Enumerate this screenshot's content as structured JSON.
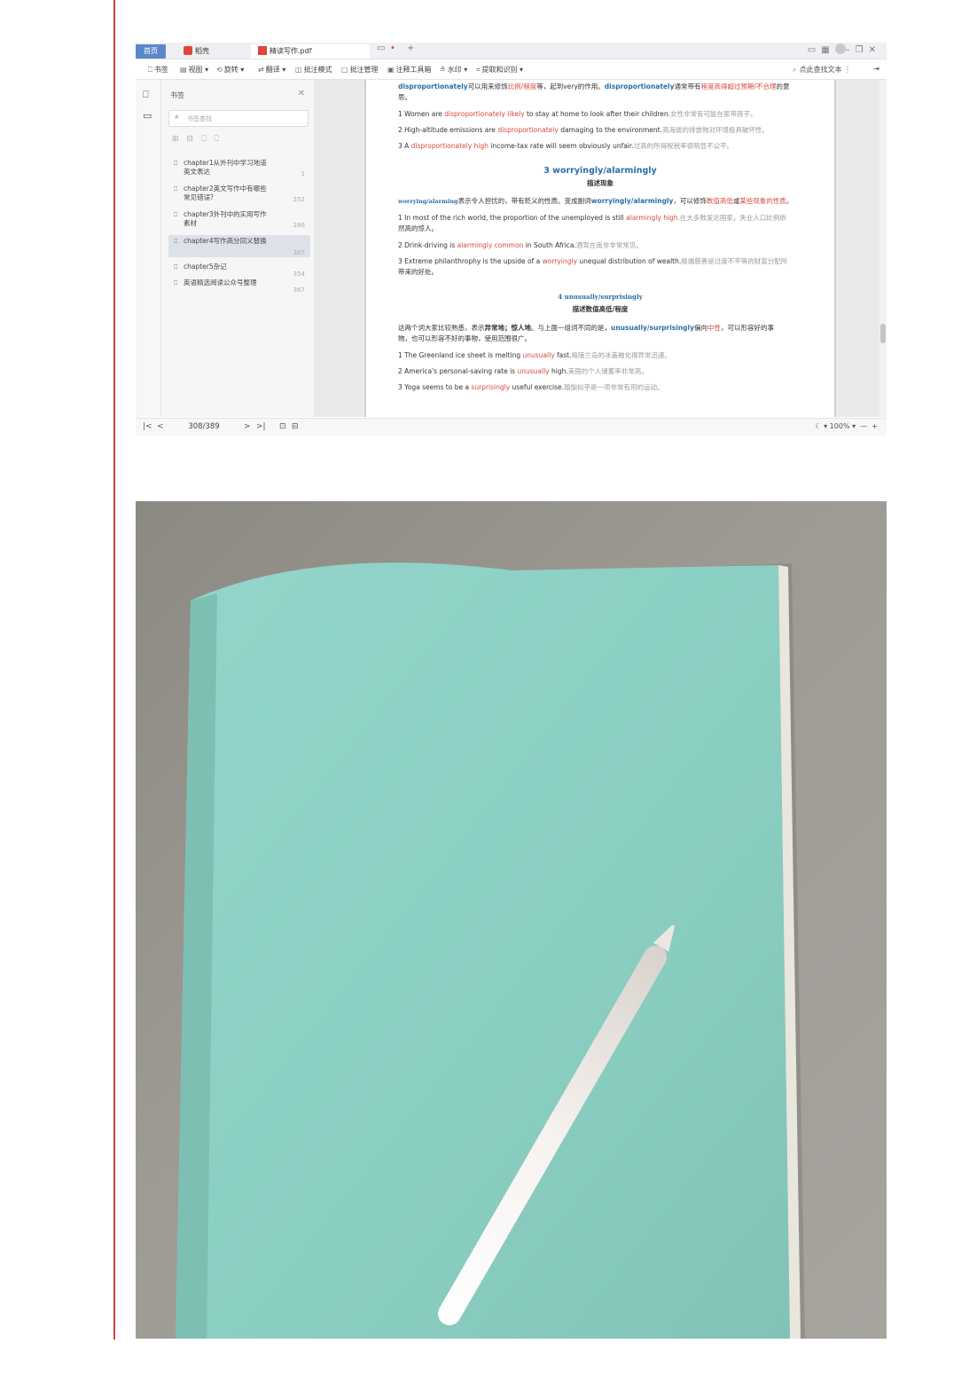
{
  "app": {
    "tabs": [
      {
        "label": "首页"
      },
      {
        "label": "稻壳"
      },
      {
        "label": "精读写作.pdf"
      }
    ],
    "toolbar": {
      "bookmark": "书签",
      "view": "视图",
      "rotate": "旋转",
      "translate": "翻译",
      "annot_mode": "批注模式",
      "annot_manage": "批注管理",
      "annot_tools": "注释工具箱",
      "watermark": "水印",
      "extract": "提取和识别",
      "find_text": "点此查找文本"
    },
    "bookmark_panel": {
      "title": "书签",
      "search_placeholder": "书签查找",
      "items": [
        {
          "label": "chapter1从外刊中学习地道英文表达",
          "page": "1"
        },
        {
          "label": "chapter2英文写作中有哪些常见错误?",
          "page": "252"
        },
        {
          "label": "chapter3外刊中的实用写作素材",
          "page": "286"
        },
        {
          "label": "chapter4写作高分同义替换",
          "page": "307"
        },
        {
          "label": "chapter5杂记",
          "page": "354"
        },
        {
          "label": "英语精选阅读公众号整理",
          "page": "367"
        }
      ]
    },
    "status": {
      "page_indicator": "308/389",
      "zoom": "100%"
    },
    "colors": {
      "accent_blue": "#2b6ea8",
      "highlight_red": "#d64a3c",
      "left_rule": "#c9433e",
      "notebook_teal": "#8fd0c5"
    }
  },
  "document": {
    "p0a": {
      "k1": "disproportionately",
      "t1": "可以用来修饰",
      "r1": "比例/程度",
      "t2": "等，起到very的作用。",
      "k2": "disproportionately",
      "t3": "通常带有",
      "r2": "程度高得超过预期/不合理",
      "t4": "的意"
    },
    "p0b": "思。",
    "e1": {
      "a": "1 Women are ",
      "r": "disproportionately likely",
      "b": " to stay at home to look after their children.",
      "g": "女性非常有可能在家带孩子。"
    },
    "e2": {
      "a": "2 High-altitude emissions are ",
      "r": "disproportionately",
      "b": " damaging to the environment.",
      "g": "高海拔的排放物对环境极具破坏性。"
    },
    "e3": {
      "a": "3 A ",
      "r": "disproportionately high",
      "b": " income-tax rate will seem obviously unfair.",
      "g": "过高的所得税税率很明显不公平。"
    },
    "h3": "3 worryingly/alarmingly",
    "h3_sub": "描述现象",
    "p3": {
      "s": "worrying/alarming",
      "t1": "表示令人担忧的，带有贬义的性质。变成副词",
      "k": "worryingly/alarmingly",
      "t2": "，可以修饰",
      "r1": "数值高低",
      "t3": "或",
      "r2": "某些现象的性质",
      "t4": "。"
    },
    "w1a": {
      "a": "1 In most of the rich world, the proportion of the unemployed is still ",
      "r": "alarmingly high",
      "g": ".在大多数发达国家，失业人口比例依"
    },
    "w1b": "然高的惊人。",
    "w2": {
      "a": "2 Drink-driving is ",
      "r": "alarmingly common",
      "b": " in South Africa.",
      "g": "酒驾在南非非常常见。"
    },
    "w3a": {
      "a": "3 Extreme philanthrophy is the upside of a ",
      "r": "worryingly",
      "b": " unequal distribution of wealth.",
      "g": "极端慈善是过度不平等的财富分配所"
    },
    "w3b": "带来的好处。",
    "h4": "4 unusually/surprisingly",
    "h4_sub": "描述数值高低/程度",
    "p4a": {
      "t1": "这两个词大家比较熟悉，表示",
      "b": "异常地；惊人地",
      "t2": "。与上面一组词不同的是，",
      "k": "unusually/surprisingly",
      "t3": "偏向",
      "r": "中性",
      "t4": "，可以形容好的事"
    },
    "p4b": "物，也可以形容不好的事物，使用范围很广。",
    "u1": {
      "a": "1 The Greenland ice sheet is melting ",
      "r": "unusually",
      "b": " fast.",
      "g": "格陵兰岛的冰盖融化得异常迅速。"
    },
    "u2": {
      "a": "2 America's personal-saving rate is ",
      "r": "unusually",
      "b": " high.",
      "g": "美国的个人储蓄率非常高。"
    },
    "u3": {
      "a": "3 Yoga seems to be a ",
      "r": "surprisingly",
      "b": " useful exercise.",
      "g": "瑜伽似乎是一项非常有用的运动。"
    }
  }
}
